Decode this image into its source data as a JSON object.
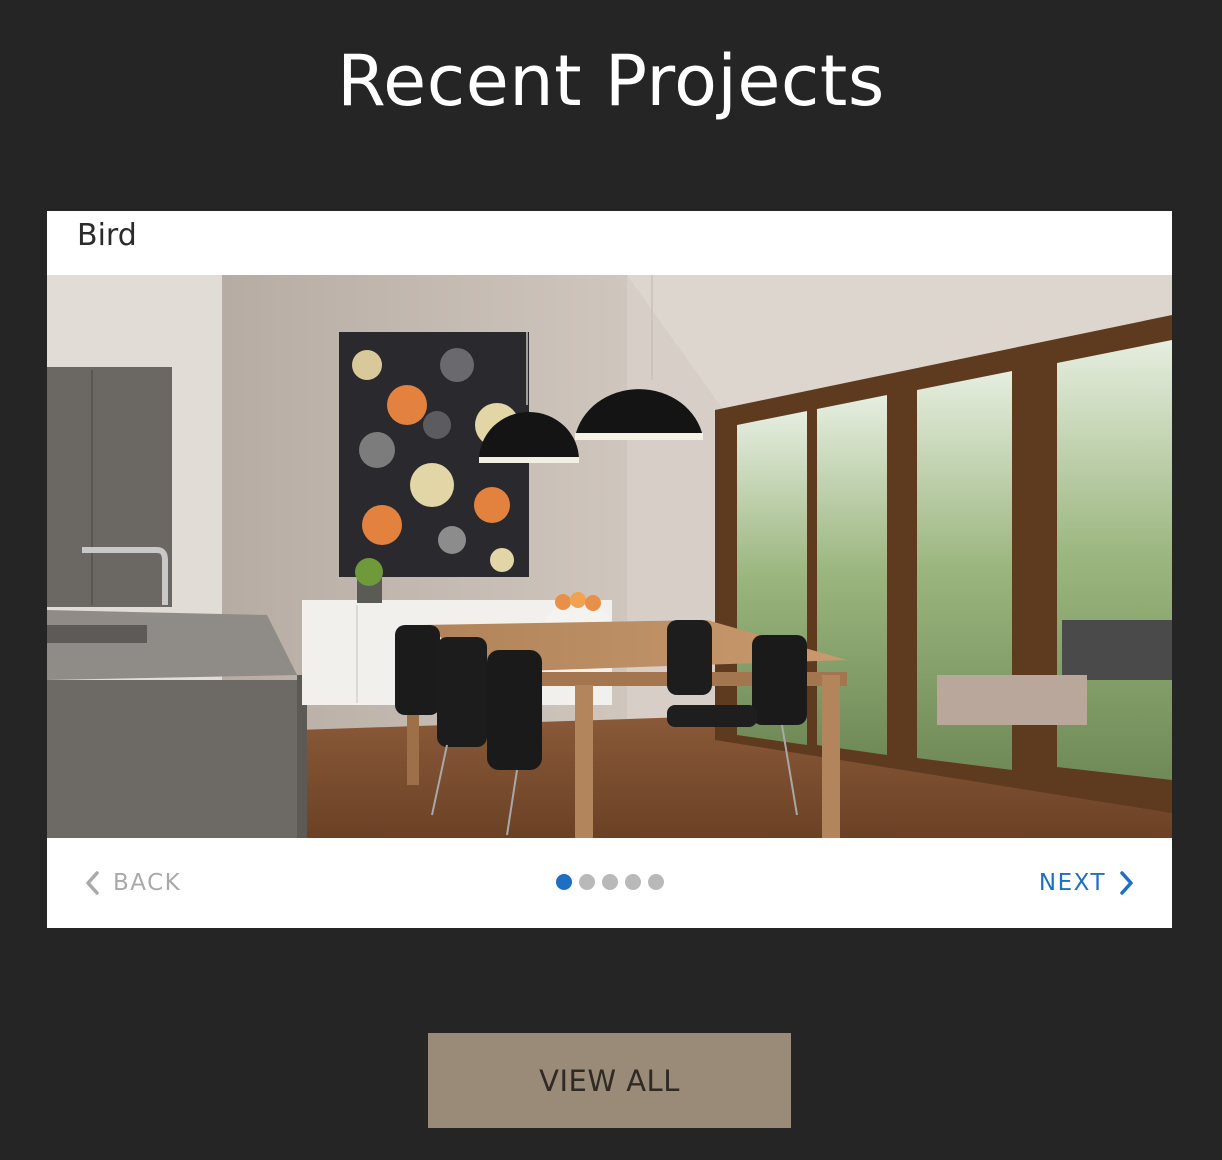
{
  "header": {
    "title": "Recent Projects"
  },
  "carousel": {
    "slide_title": "Bird",
    "slide_count": 5,
    "active_index": 0,
    "back_label": "BACK",
    "next_label": "NEXT",
    "back_icon": "chevron-left-icon",
    "next_icon": "chevron-right-icon"
  },
  "footer": {
    "view_all_label": "VIEW ALL"
  },
  "colors": {
    "background": "#252525",
    "accent": "#1d6fc2",
    "button": "#9a8a78",
    "dot_inactive": "#b9b9b9"
  }
}
